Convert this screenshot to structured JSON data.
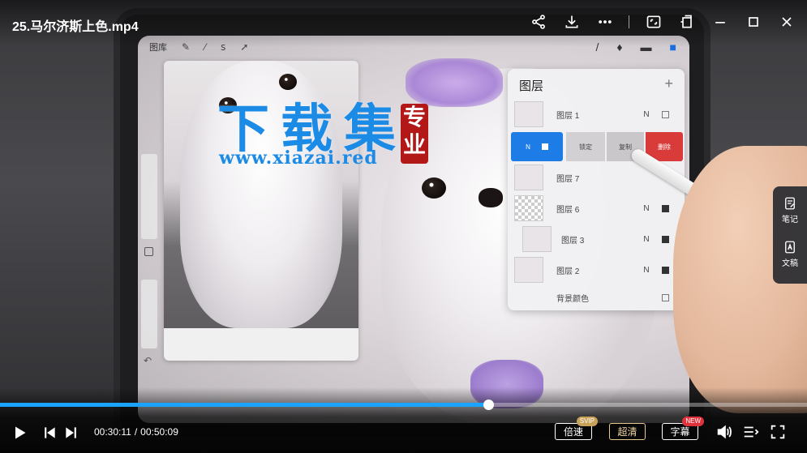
{
  "window": {
    "title": "25.马尔济斯上色.mp4"
  },
  "top_icons": [
    "share-icon",
    "download-icon",
    "more-icon",
    "screen-capture-icon",
    "pin-window-icon",
    "minimize-icon",
    "maximize-icon",
    "close-icon"
  ],
  "procreate": {
    "gallery_label": "图库",
    "tools": [
      "wrench-icon",
      "magic-wand-icon",
      "selection-icon",
      "transform-icon"
    ],
    "right_tools": [
      "brush-icon",
      "smudge-icon",
      "eraser-icon",
      "layers-icon"
    ]
  },
  "watermark": {
    "text": "下载集",
    "url": "www.xiazai.red",
    "seal_text": "专业"
  },
  "layers_panel": {
    "title": "图层",
    "add_symbol": "+",
    "rows": [
      {
        "name": "图层 1",
        "blend": "N",
        "visible": false
      },
      {
        "name": "图层 7",
        "blend": "",
        "visible": null
      },
      {
        "name": "图层 6",
        "blend": "N",
        "visible": true
      },
      {
        "name": "图层 3",
        "blend": "N",
        "visible": true
      },
      {
        "name": "图层 2",
        "blend": "N",
        "visible": true
      },
      {
        "name": "背景颜色",
        "blend": "",
        "visible": false
      }
    ],
    "swipe_actions": {
      "selected_blend": "N",
      "lock": "锁定",
      "duplicate": "复制",
      "delete": "删除"
    }
  },
  "side_panel": {
    "notes_label": "笔记",
    "doc_label": "文稿"
  },
  "player": {
    "current_time": "00:30:11",
    "separator": "/",
    "total_time": "00:50:09",
    "progress_fraction": 0.605,
    "speed_label": "倍速",
    "speed_badge": "SVIP",
    "quality_label": "超清",
    "subtitle_label": "字幕",
    "subtitle_badge": "NEW",
    "accent_color": "#1aa3ff"
  }
}
